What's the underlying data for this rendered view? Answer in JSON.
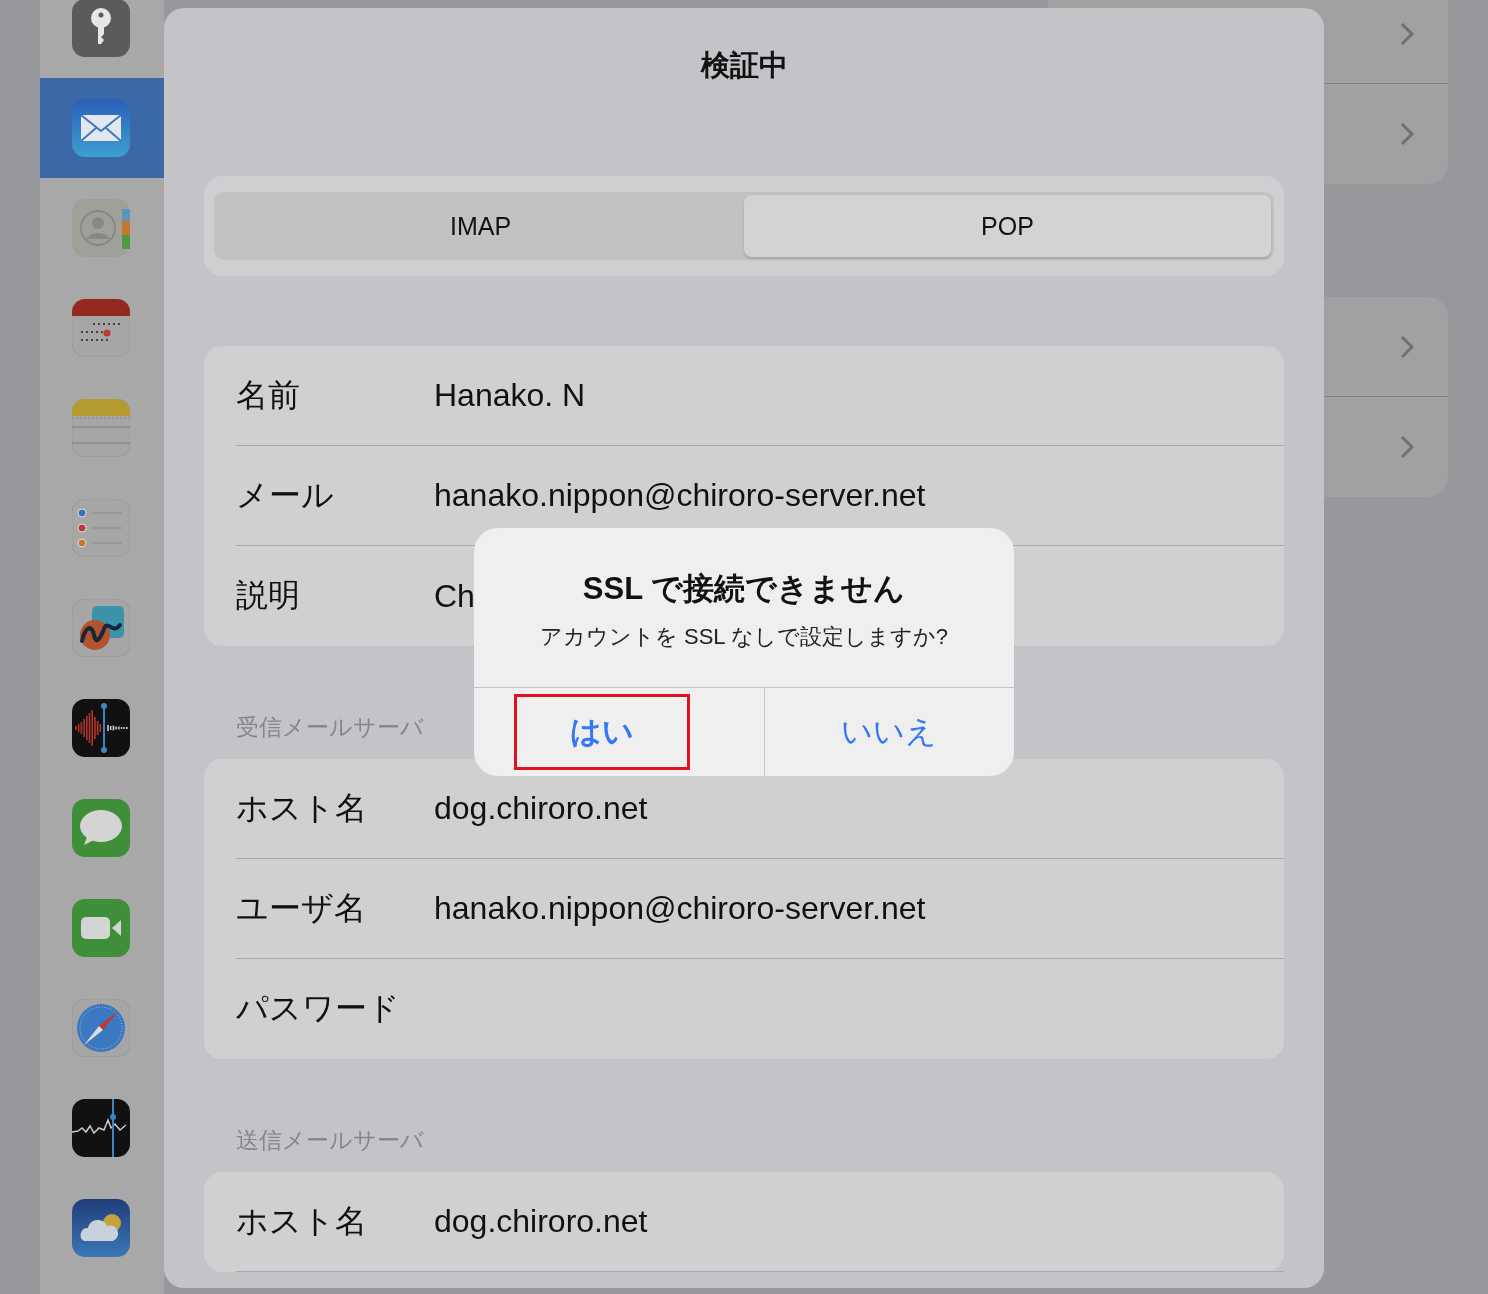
{
  "sidebar": {
    "items": [
      {
        "kind": "key",
        "selected": false
      },
      {
        "kind": "mail",
        "selected": true
      },
      {
        "kind": "contacts",
        "selected": false
      },
      {
        "kind": "calendar",
        "selected": false
      },
      {
        "kind": "notes",
        "selected": false
      },
      {
        "kind": "reminders",
        "selected": false
      },
      {
        "kind": "freeform",
        "selected": false
      },
      {
        "kind": "voice",
        "selected": false
      },
      {
        "kind": "messages",
        "selected": false
      },
      {
        "kind": "facetime",
        "selected": false
      },
      {
        "kind": "safari",
        "selected": false
      },
      {
        "kind": "stocks",
        "selected": false
      },
      {
        "kind": "weather",
        "selected": false
      }
    ]
  },
  "sheet": {
    "title": "検証中",
    "segments": [
      {
        "label": "IMAP",
        "selected": false
      },
      {
        "label": "POP",
        "selected": true
      }
    ],
    "sections": [
      {
        "rows": [
          {
            "label": "名前",
            "value": "Hanako. N"
          },
          {
            "label": "メール",
            "value": "hanako.nippon@chiroro-server.net"
          },
          {
            "label": "説明",
            "value": "Ch"
          }
        ]
      },
      {
        "header": "受信メールサーバ",
        "rows": [
          {
            "label": "ホスト名",
            "value": "dog.chiroro.net"
          },
          {
            "label": "ユーザ名",
            "value": "hanako.nippon@chiroro-server.net"
          },
          {
            "label": "パスワード"
          }
        ]
      },
      {
        "header": "送信メールサーバ",
        "rows": [
          {
            "label": "ホスト名",
            "value": "dog.chiroro.net"
          }
        ]
      }
    ]
  },
  "alert": {
    "title": "SSL で接続できません",
    "message": "アカウントを SSL なしで設定しますか?",
    "buttons": [
      {
        "label": "はい",
        "bold": true,
        "outlined": true
      },
      {
        "label": "いいえ",
        "bold": false,
        "outlined": false
      }
    ]
  }
}
